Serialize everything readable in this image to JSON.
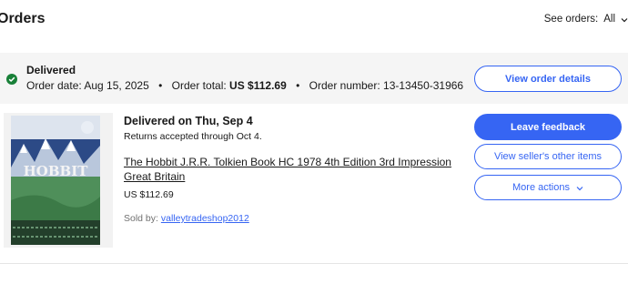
{
  "header": {
    "title": "Orders",
    "see_orders_label": "See orders:",
    "see_orders_value": "All"
  },
  "order": {
    "status": "Delivered",
    "date_label": "Order date:",
    "date": "Aug 15, 2025",
    "separator": "•",
    "total_label": "Order total:",
    "total": "US $112.69",
    "number_label": "Order number:",
    "number": "13-13450-31966",
    "view_details_label": "View order details"
  },
  "item": {
    "delivery_status": "Delivered on Thu, Sep 4",
    "returns_text": "Returns accepted through Oct 4.",
    "title": "The Hobbit J.R.R. Tolkien Book HC 1978 4th Edition 3rd Impression Great Britain",
    "price": "US $112.69",
    "sold_by_label": "Sold by:",
    "seller": "valleytradeshop2012",
    "cover_text": "HOBBIT"
  },
  "actions": {
    "leave_feedback": "Leave feedback",
    "seller_other_items": "View seller's other items",
    "more_actions": "More actions"
  },
  "colors": {
    "accent": "#3665f3",
    "success": "#188038",
    "header_bg": "#f5f5f5"
  },
  "icons": {
    "status": "check-circle-icon",
    "dropdown": "chevron-down-icon"
  }
}
